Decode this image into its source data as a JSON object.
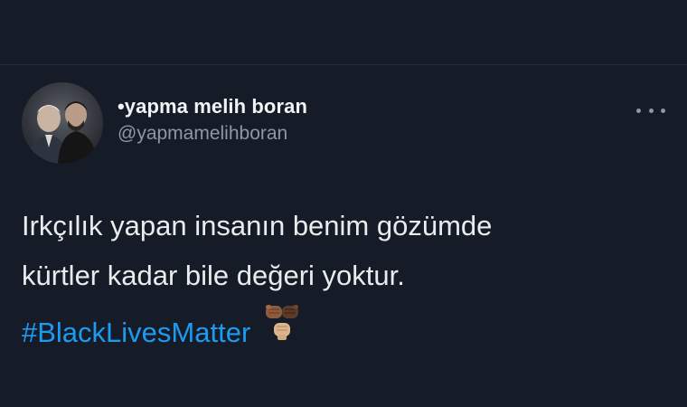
{
  "tweet": {
    "author": {
      "display_name": "•yapma melih boran",
      "handle": "@yapmamelihboran"
    },
    "text_lines": [
      "Irkçılık yapan insanın benim gözümde",
      "kürtler kadar bile değeri yoktur."
    ],
    "hashtag": "#BlackLivesMatter",
    "emoji": [
      "raised-fist-medium-dark",
      "raised-fist-dark",
      "raised-fist-medium-light"
    ],
    "more_icon": "more-horizontal-icon",
    "colors": {
      "background": "#151c27",
      "text": "#e9ebed",
      "secondary": "#8b98a5",
      "link": "#1d9bf0"
    }
  }
}
